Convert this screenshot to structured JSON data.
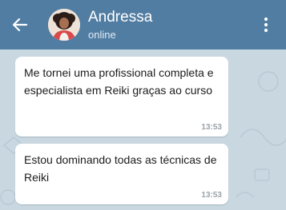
{
  "header": {
    "contact_name": "Andressa",
    "status": "online",
    "background": "#517da2"
  },
  "icons": {
    "back": "arrow-left-icon",
    "menu": "more-vertical-icon"
  },
  "chat": {
    "background": "#c8d7e0",
    "messages": [
      {
        "text": "Me tornei uma profissional completa e especialista em Reiki graças ao curso",
        "time": "13:53"
      },
      {
        "text": "Estou dominando todas as técnicas de Reiki",
        "time": "13:53"
      }
    ]
  }
}
